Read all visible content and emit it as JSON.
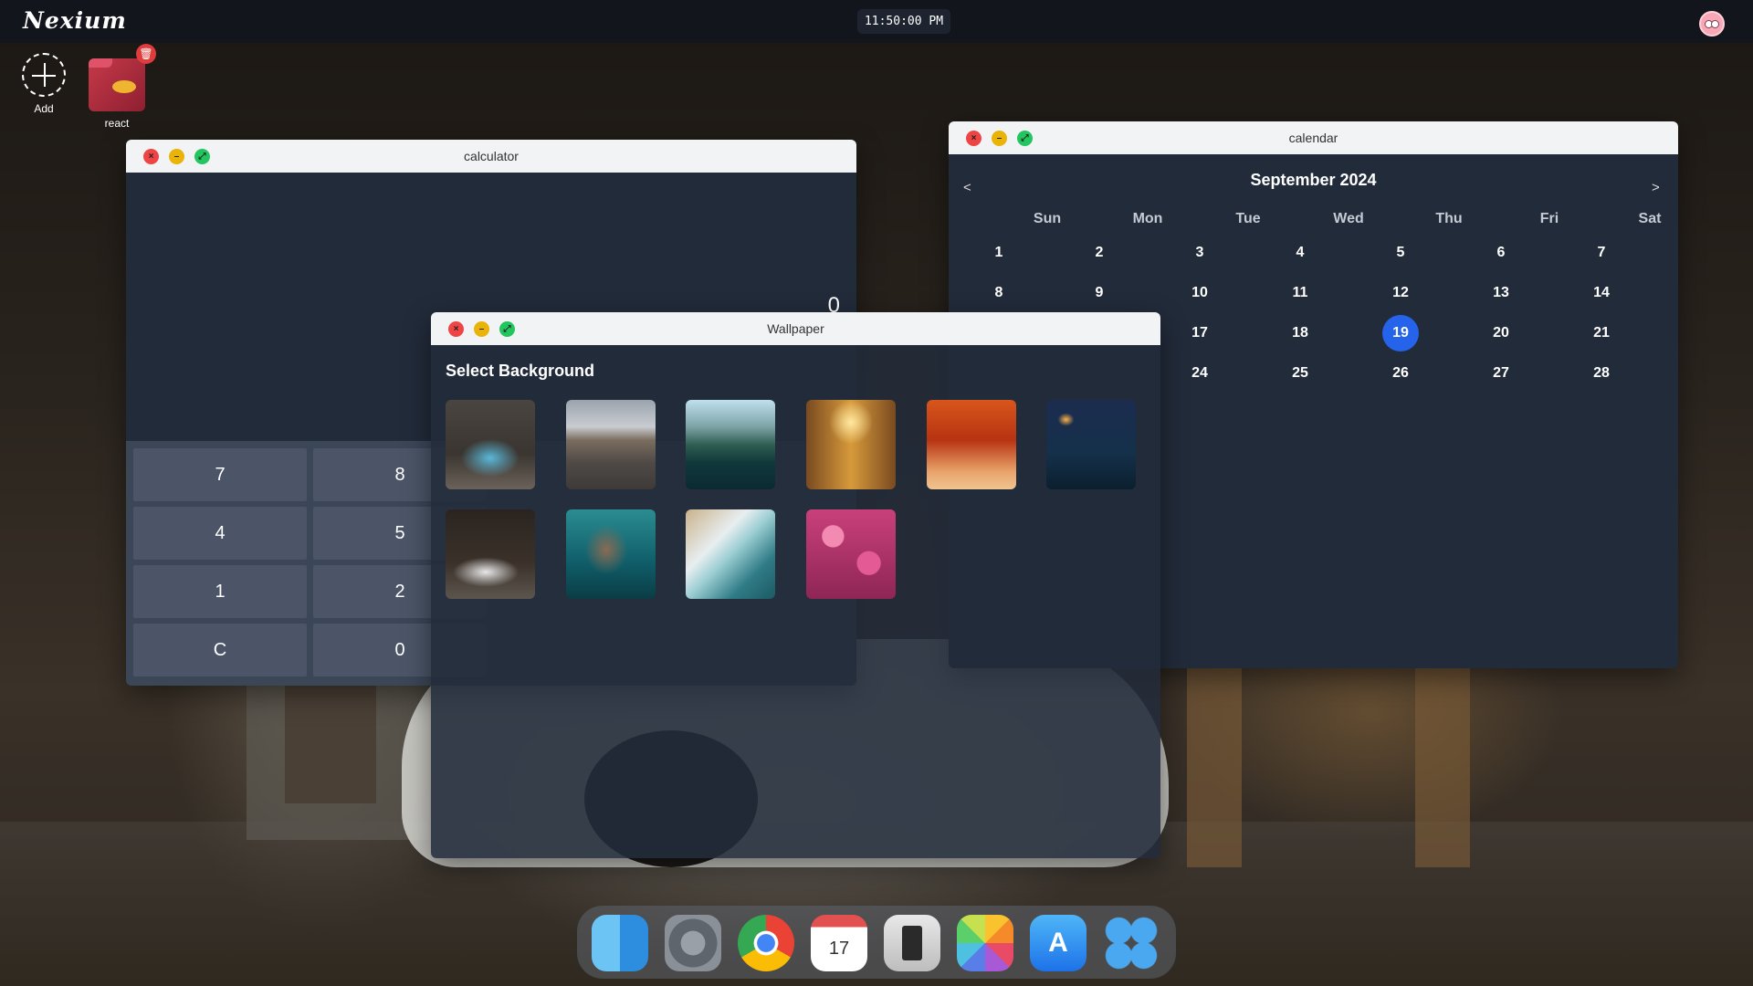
{
  "topbar": {
    "logo": "Nexium",
    "clock": "11:50:00 PM"
  },
  "desktop": {
    "add_label": "Add",
    "folder_label": "react"
  },
  "calculator": {
    "title": "calculator",
    "display": "0",
    "keys": [
      "7",
      "8",
      "4",
      "5",
      "1",
      "2",
      "C",
      "0"
    ]
  },
  "calendar": {
    "title": "calendar",
    "month_label": "September 2024",
    "prev": "<",
    "next": ">",
    "weekdays": [
      "Sun",
      "Mon",
      "Tue",
      "Wed",
      "Thu",
      "Fri",
      "Sat"
    ],
    "days": [
      "1",
      "2",
      "3",
      "4",
      "5",
      "6",
      "7",
      "8",
      "9",
      "10",
      "11",
      "12",
      "13",
      "14",
      "17",
      "18",
      "19",
      "20",
      "21",
      "24",
      "25",
      "26",
      "27",
      "28"
    ],
    "today": "19"
  },
  "wallpaper": {
    "title": "Wallpaper",
    "heading": "Select Background",
    "thumbnails": [
      "sea-cave",
      "desert-road",
      "mountain-lake",
      "sunlit-forest",
      "autumn-park",
      "night-cabin",
      "white-car-night",
      "underwater-rock",
      "ocean-waves",
      "pink-flowers"
    ]
  },
  "dock": {
    "apps": [
      "finder-icon",
      "settings-icon",
      "chrome-icon",
      "calendar-icon",
      "calculator-icon",
      "photos-icon",
      "app-store-icon",
      "launchpad-icon"
    ],
    "calendar_icon_day": "17"
  }
}
